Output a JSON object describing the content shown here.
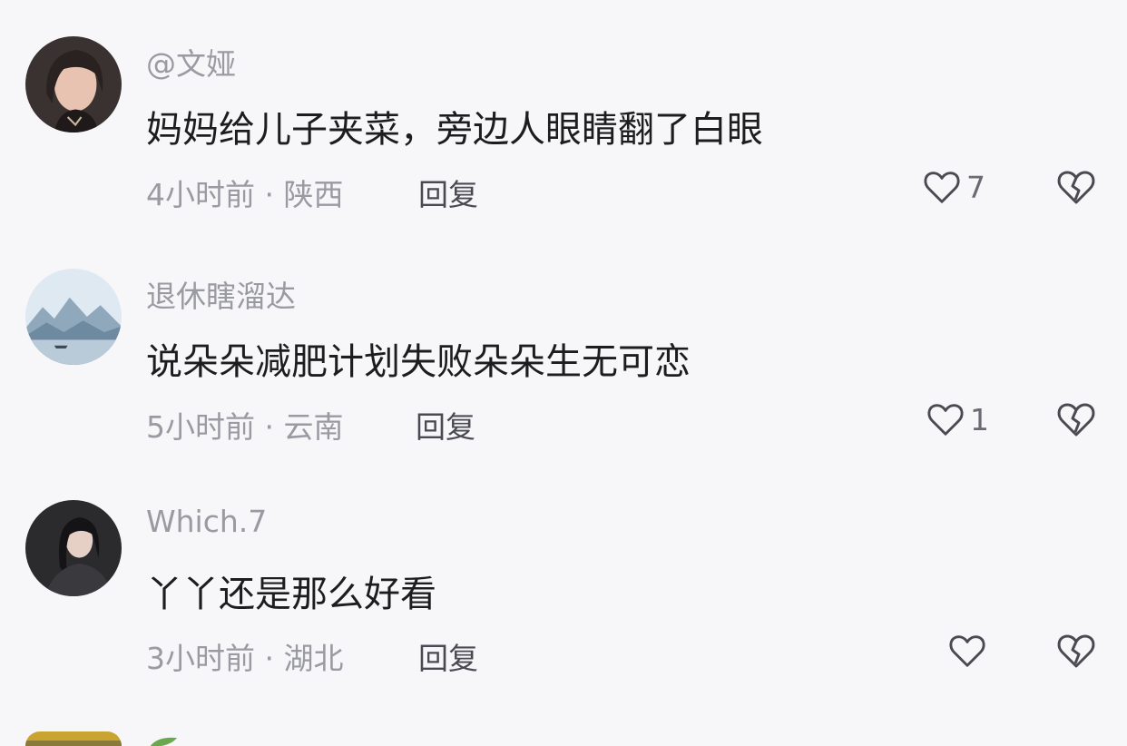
{
  "comments": [
    {
      "username": "@文娅",
      "text": "妈妈给儿子夹菜，旁边人眼睛翻了白眼",
      "time": "4小时前",
      "separator": "·",
      "location": "陕西",
      "reply_label": "回复",
      "likes": "7"
    },
    {
      "username": "退休瞎溜达",
      "text": "说朵朵减肥计划失败朵朵生无可恋",
      "time": "5小时前",
      "separator": "·",
      "location": "云南",
      "reply_label": "回复",
      "likes": "1"
    },
    {
      "username": "Which.7",
      "text": "丫丫还是那么好看",
      "time": "3小时前",
      "separator": "·",
      "location": "湖北",
      "reply_label": "回复",
      "likes": ""
    }
  ],
  "colors": {
    "background": "#f7f7f9",
    "text_primary": "#1d1d1f",
    "text_secondary": "#9a9aa2",
    "icon": "#4a4a52"
  },
  "icons": {
    "like": "heart-outline-icon",
    "dislike": "broken-heart-icon"
  }
}
